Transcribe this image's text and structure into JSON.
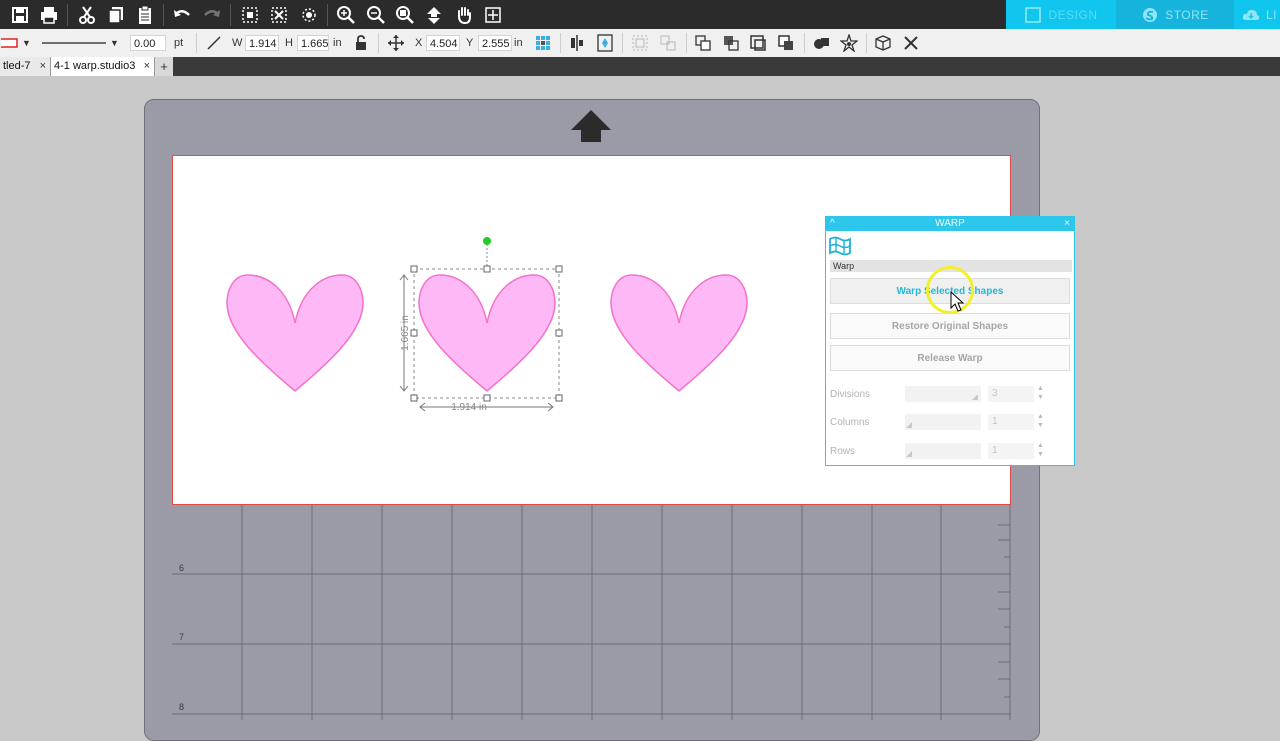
{
  "toolbar": {
    "icons": [
      "save-icon",
      "print-icon",
      "cut-icon",
      "copy-icon",
      "paste-icon",
      "undo-icon",
      "redo-icon",
      "select-icon",
      "deselect-icon",
      "edit-points-icon",
      "zoom-in-icon",
      "zoom-out-icon",
      "zoom-fit-icon",
      "move-down-icon",
      "pan-icon",
      "page-fit-icon"
    ]
  },
  "mode_tabs": {
    "design": "DESIGN",
    "store": "STORE",
    "library": "LI"
  },
  "properties": {
    "line_width_value": "0.00",
    "line_width_unit": "pt",
    "w_label": "W",
    "w_value": "1.914",
    "h_label": "H",
    "h_value": "1.665",
    "size_unit": "in",
    "x_label": "X",
    "x_value": "4.504",
    "y_label": "Y",
    "y_value": "2.555",
    "pos_unit": "in"
  },
  "doc_tabs": [
    {
      "label": "tled-7",
      "close": "×"
    },
    {
      "label": "4-1 warp.studio3",
      "close": "×"
    }
  ],
  "add_tab": "+",
  "canvas": {
    "selection_width": "1.914 in",
    "selection_height": "1.665 in",
    "grid_rows": [
      "6",
      "7",
      "8"
    ],
    "heart_fill": "#ffb8f6",
    "heart_stroke": "#f272c6"
  },
  "warp": {
    "title": "WARP",
    "collapse": "^",
    "close": "×",
    "section_label": "Warp",
    "warp_button": "Warp Selected Shapes",
    "restore_button": "Restore Original Shapes",
    "release_button": "Release Warp",
    "divisions_label": "Divisions",
    "divisions_value": "3",
    "columns_label": "Columns",
    "columns_value": "1",
    "rows_label": "Rows",
    "rows_value": "1",
    "accent": "#2ec7ec"
  }
}
